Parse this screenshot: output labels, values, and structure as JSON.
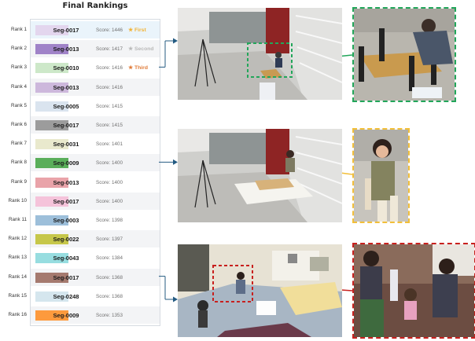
{
  "title": "Final Rankings",
  "rankings": [
    {
      "rank": "Rank 1",
      "seg": "Seg-0017",
      "score": "Score: 1446",
      "medal": "★ First",
      "medal_color": "#f2b233",
      "color": "#e3d6ee"
    },
    {
      "rank": "Rank 2",
      "seg": "Seg-0013",
      "score": "Score: 1417",
      "medal": "★ Second",
      "medal_color": "#b9b9b9",
      "color": "#a083c8"
    },
    {
      "rank": "Rank 3",
      "seg": "Seg-0010",
      "score": "Score: 1416",
      "medal": "★ Third",
      "medal_color": "#e07b39",
      "color": "#cde8c9"
    },
    {
      "rank": "Rank 4",
      "seg": "Seg-0013",
      "score": "Score: 1416",
      "medal": "",
      "color": "#cdb8dc"
    },
    {
      "rank": "Rank 5",
      "seg": "Seg-0005",
      "score": "Score: 1415",
      "medal": "",
      "color": "#dae4ef"
    },
    {
      "rank": "Rank 6",
      "seg": "Seg-0017",
      "score": "Score: 1415",
      "medal": "",
      "color": "#9c9c9c"
    },
    {
      "rank": "Rank 7",
      "seg": "Seg-0031",
      "score": "Score: 1401",
      "medal": "",
      "color": "#e9e9cd"
    },
    {
      "rank": "Rank 8",
      "seg": "Seg-0009",
      "score": "Score: 1400",
      "medal": "",
      "color": "#5aae5a"
    },
    {
      "rank": "Rank 9",
      "seg": "Seg-0013",
      "score": "Score: 1400",
      "medal": "",
      "color": "#e9a3a9"
    },
    {
      "rank": "Rank 10",
      "seg": "Seg-0017",
      "score": "Score: 1400",
      "medal": "",
      "color": "#f5c3da"
    },
    {
      "rank": "Rank 11",
      "seg": "Seg-0003",
      "score": "Score: 1398",
      "medal": "",
      "color": "#9dbfda"
    },
    {
      "rank": "Rank 12",
      "seg": "Seg-0022",
      "score": "Score: 1397",
      "medal": "",
      "color": "#c6c74a"
    },
    {
      "rank": "Rank 13",
      "seg": "Seg-0043",
      "score": "Score: 1384",
      "medal": "",
      "color": "#97dde0"
    },
    {
      "rank": "Rank 14",
      "seg": "Seg-0017",
      "score": "Score: 1368",
      "medal": "",
      "color": "#a57a6f"
    },
    {
      "rank": "Rank 15",
      "seg": "Seg-0248",
      "score": "Score: 1368",
      "medal": "",
      "color": "#d5e6ee"
    },
    {
      "rank": "Rank 16",
      "seg": "Seg-0009",
      "score": "Score: 1353",
      "medal": "",
      "color": "#fd9a3d"
    }
  ],
  "colors": {
    "connector": "#245b82",
    "highlight_green": "#22a65a",
    "highlight_yellow": "#f2bf3a",
    "highlight_red": "#c8201e"
  },
  "scenes": [
    "lab-table-assembly",
    "lab-pipe-stacking",
    "living-room-play"
  ]
}
